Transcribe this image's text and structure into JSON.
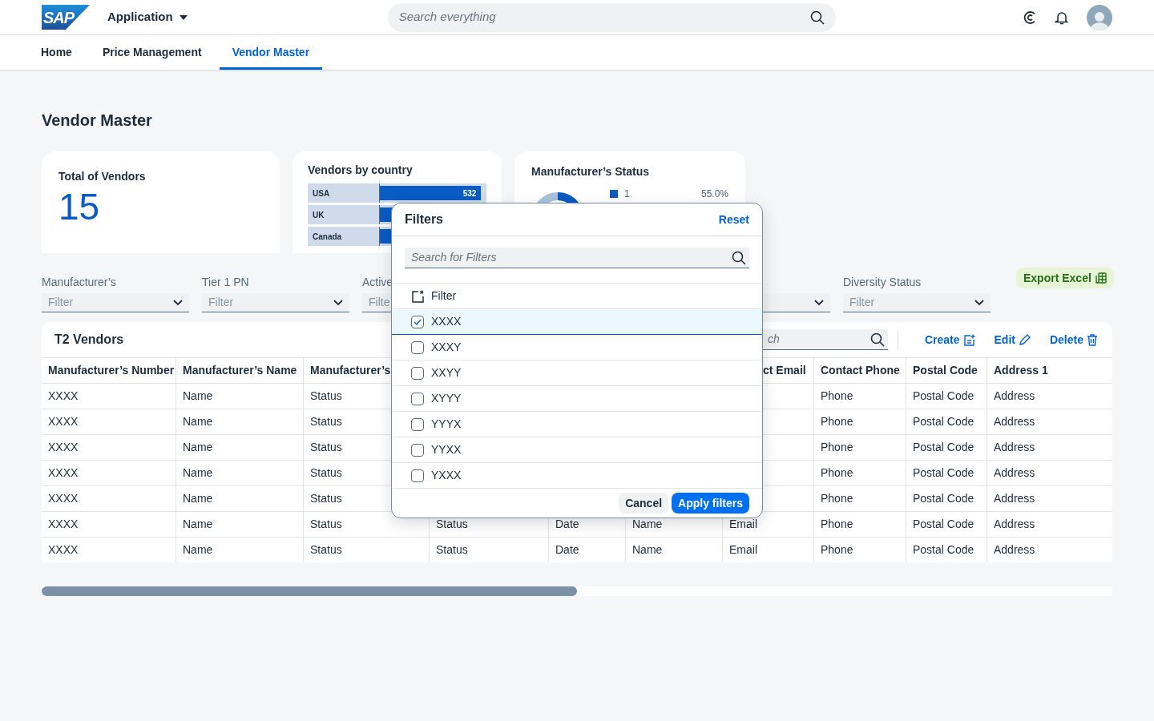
{
  "header": {
    "logo": "SAP",
    "app_menu": "Application",
    "search": {
      "placeholder": "Search everything"
    }
  },
  "tabs": [
    {
      "label": "Home",
      "selected": false
    },
    {
      "label": "Price Management",
      "selected": false
    },
    {
      "label": "Vendor Master",
      "selected": true
    }
  ],
  "page_title": "Vendor Master",
  "kpi": {
    "title": "Total of Vendors",
    "value": "15"
  },
  "country_card": {
    "title": "Vendors by country",
    "bars": [
      {
        "label": "USA",
        "level": 0.95,
        "value_label": "532"
      },
      {
        "label": "UK",
        "level": 0.3
      },
      {
        "label": "Canada",
        "level": 0.12
      }
    ]
  },
  "status_card": {
    "title": "Manufacturer’s Status",
    "legend": [
      {
        "label": "1",
        "value": "55.0%"
      }
    ]
  },
  "filters": [
    {
      "kind": "select",
      "label": "Manufacturer’s",
      "placeholder": "Filter"
    },
    {
      "kind": "select",
      "label": "Tier 1 PN",
      "placeholder": "Filter"
    },
    {
      "kind": "select",
      "label": "Active",
      "placeholder": "Filte"
    },
    {
      "kind": "covered"
    },
    {
      "kind": "covered_select"
    },
    {
      "kind": "select",
      "label": "Diversity Status",
      "placeholder": "Filter"
    }
  ],
  "export_button": "Export Excel",
  "table": {
    "title": "T2 Vendors",
    "search": {
      "placeholder": "ch"
    },
    "actions": [
      {
        "kind": "create",
        "label": "Create"
      },
      {
        "kind": "edit",
        "label": "Edit"
      },
      {
        "kind": "delete",
        "label": "Delete"
      }
    ],
    "columns": [
      "Manufacturer’s Number",
      "Manufacturer’s Name",
      "Manufacturer’s",
      "",
      "",
      "",
      "ct Email",
      "Contact Phone",
      "Postal Code",
      "Address 1"
    ],
    "rows": [
      [
        "XXXX",
        "Name",
        "Status",
        "",
        "",
        "",
        "",
        "Phone",
        "Postal Code",
        "Address"
      ],
      [
        "XXXX",
        "Name",
        "Status",
        "",
        "",
        "",
        "",
        "Phone",
        "Postal Code",
        "Address"
      ],
      [
        "XXXX",
        "Name",
        "Status",
        "",
        "",
        "",
        "",
        "Phone",
        "Postal Code",
        "Address"
      ],
      [
        "XXXX",
        "Name",
        "Status",
        "",
        "",
        "",
        "",
        "Phone",
        "Postal Code",
        "Address"
      ],
      [
        "XXXX",
        "Name",
        "Status",
        "",
        "",
        "",
        "",
        "Phone",
        "Postal Code",
        "Address"
      ],
      [
        "XXXX",
        "Name",
        "Status",
        "Status",
        "Date",
        "Name",
        "Email",
        "Phone",
        "Postal Code",
        "Address"
      ],
      [
        "XXXX",
        "Name",
        "Status",
        "Status",
        "Date",
        "Name",
        "Email",
        "Phone",
        "Postal Code",
        "Address"
      ]
    ]
  },
  "popover": {
    "title": "Filters",
    "reset": "Reset",
    "search": {
      "placeholder": "Search for Filters"
    },
    "clear_label": "Filter",
    "options": [
      {
        "label": "XXXX",
        "checked": true,
        "selected": true
      },
      {
        "label": "XXXY",
        "checked": false,
        "selected": false
      },
      {
        "label": "XXYY",
        "checked": false,
        "selected": false
      },
      {
        "label": "XYYY",
        "checked": false,
        "selected": false
      },
      {
        "label": "YYYX",
        "checked": false,
        "selected": false
      },
      {
        "label": "YYXX",
        "checked": false,
        "selected": false
      },
      {
        "label": "YXXX",
        "checked": false,
        "selected": false
      }
    ],
    "cancel": "Cancel",
    "apply": "Apply filters"
  }
}
